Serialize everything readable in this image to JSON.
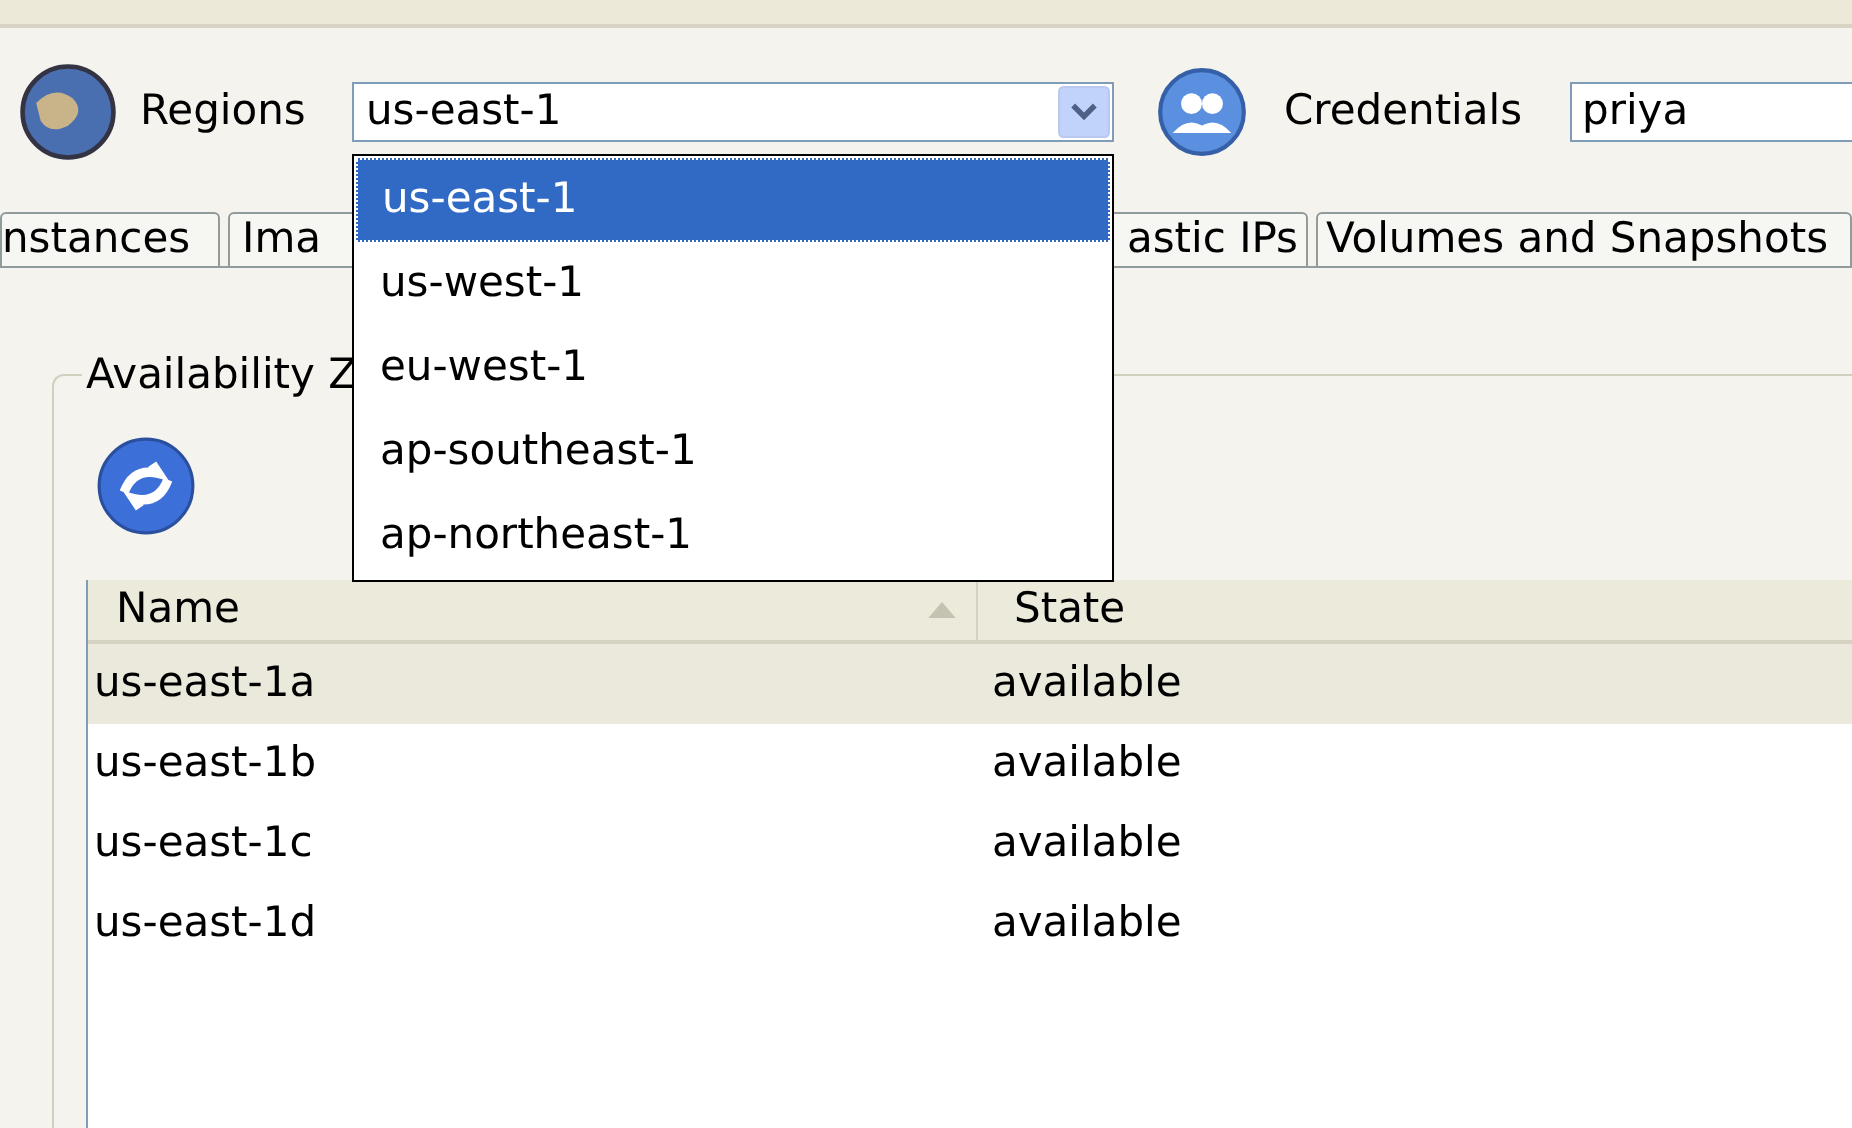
{
  "toolbar": {
    "regions_label": "Regions",
    "region_value": "us-east-1",
    "credentials_label": "Credentials",
    "credentials_value": "priya"
  },
  "tabs": [
    {
      "label": "nstances",
      "selected": false
    },
    {
      "label": "Ima",
      "selected": false
    },
    {
      "label": "astic IPs",
      "selected": false
    },
    {
      "label": "Volumes and Snapshots",
      "selected": false
    }
  ],
  "group": {
    "title": "Availability Z"
  },
  "table": {
    "columns": [
      "Name",
      "State"
    ],
    "rows": [
      {
        "cells": [
          "us-east-1a",
          "available"
        ],
        "selected": true
      },
      {
        "cells": [
          "us-east-1b",
          "available"
        ],
        "selected": false
      },
      {
        "cells": [
          "us-east-1c",
          "available"
        ],
        "selected": false
      },
      {
        "cells": [
          "us-east-1d",
          "available"
        ],
        "selected": false
      }
    ]
  },
  "dropdown": {
    "items": [
      {
        "label": "us-east-1",
        "selected": true
      },
      {
        "label": "us-west-1",
        "selected": false
      },
      {
        "label": "eu-west-1",
        "selected": false
      },
      {
        "label": "ap-southeast-1",
        "selected": false
      },
      {
        "label": "ap-northeast-1",
        "selected": false
      }
    ]
  }
}
